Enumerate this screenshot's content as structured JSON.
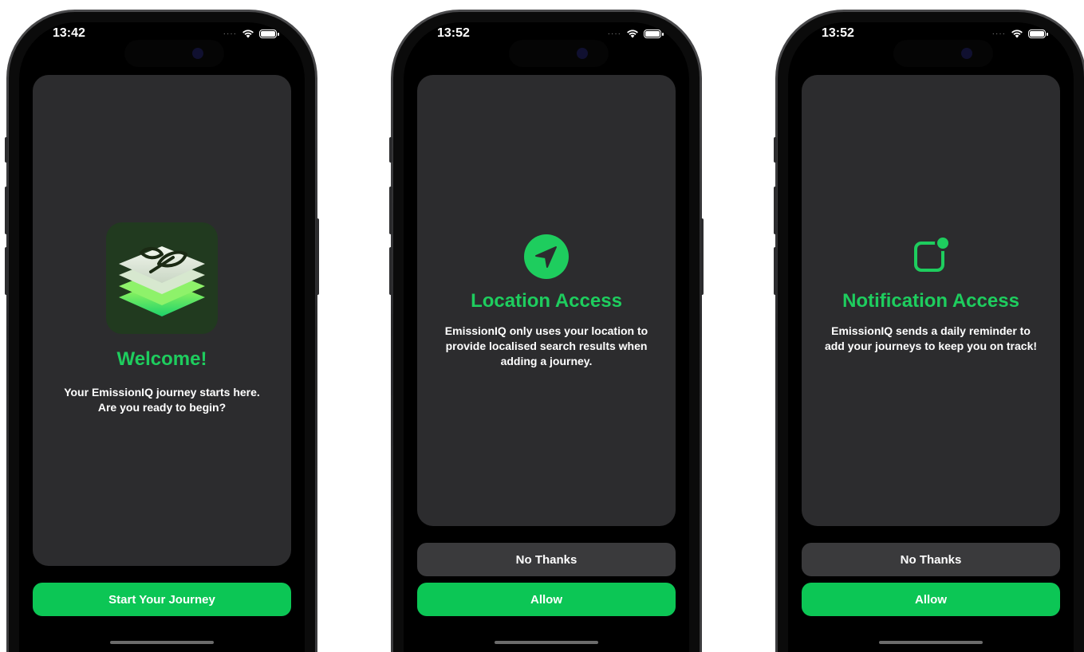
{
  "screens": [
    {
      "time": "13:42",
      "icon": "emissioniq-app-icon",
      "title": "Welcome!",
      "description": "Your EmissionIQ journey starts here. Are you ready to begin?",
      "primary_button": "Start Your Journey"
    },
    {
      "time": "13:52",
      "icon": "location-arrow-icon",
      "title": "Location Access",
      "description": "EmissionIQ only uses your location to provide localised search results when adding a journey.",
      "secondary_button": "No Thanks",
      "primary_button": "Allow"
    },
    {
      "time": "13:52",
      "icon": "notification-badge-icon",
      "title": "Notification Access",
      "description": "EmissionIQ sends a daily reminder to add your journeys to keep you on track!",
      "secondary_button": "No Thanks",
      "primary_button": "Allow"
    }
  ],
  "colors": {
    "accent": "#0cc655",
    "title": "#1ecd5e",
    "card": "#2c2c2e",
    "secondary_button": "#3a3a3c"
  }
}
